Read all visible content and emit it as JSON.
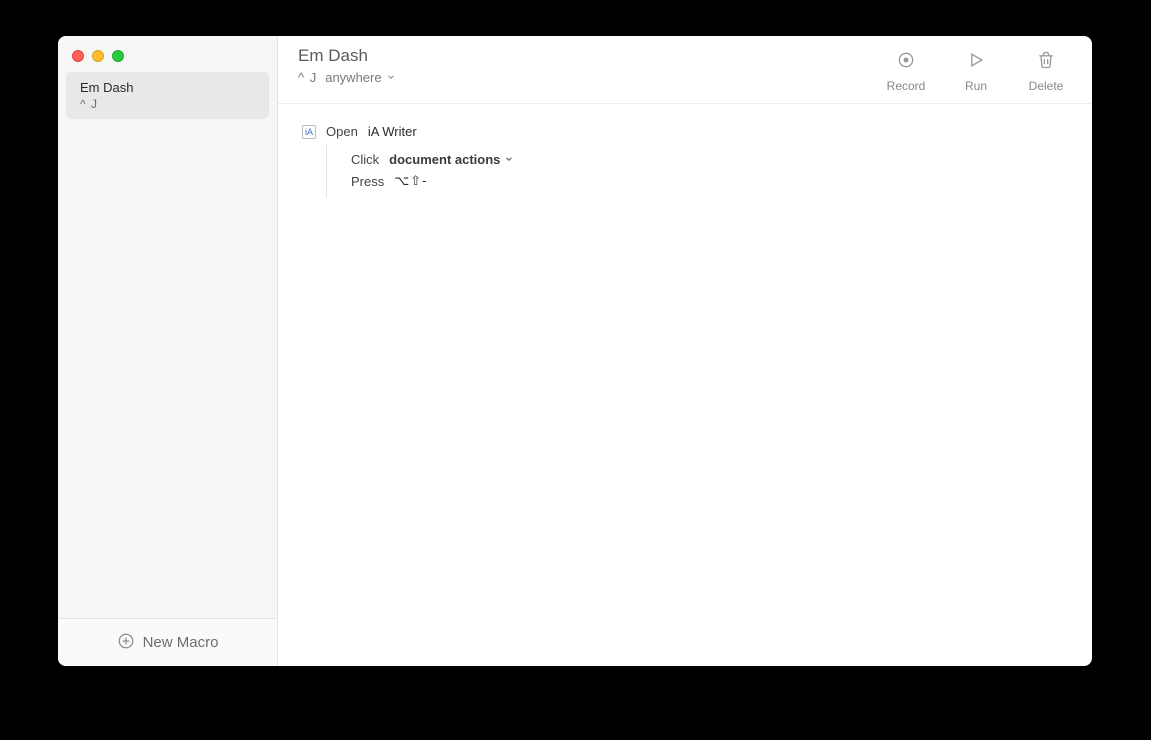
{
  "sidebar": {
    "items": [
      {
        "title": "Em Dash",
        "shortcut": "^ J"
      }
    ],
    "new_macro_label": "New Macro"
  },
  "header": {
    "title": "Em Dash",
    "shortcut": "^ J",
    "scope_label": "anywhere"
  },
  "toolbar": {
    "record_label": "Record",
    "run_label": "Run",
    "delete_label": "Delete"
  },
  "steps": {
    "open": {
      "verb": "Open",
      "target": "iA Writer"
    },
    "click": {
      "verb": "Click",
      "target": "document actions"
    },
    "press": {
      "verb": "Press",
      "keys": "⌥⇧-"
    }
  }
}
